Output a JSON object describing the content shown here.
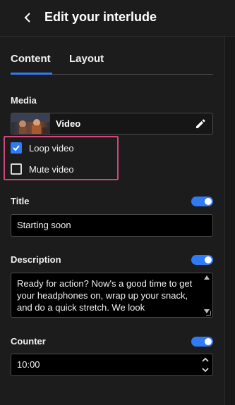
{
  "header": {
    "title": "Edit your interlude",
    "back_icon": "chevron-left-icon"
  },
  "tabs": [
    {
      "label": "Content",
      "active": true
    },
    {
      "label": "Layout",
      "active": false
    }
  ],
  "accent_color": "#2f7bf5",
  "highlight_color": "#d0467d",
  "media": {
    "section_label": "Media",
    "card_label": "Video",
    "edit_icon": "pencil-icon",
    "loop": {
      "label": "Loop video",
      "checked": true
    },
    "mute": {
      "label": "Mute video",
      "checked": false
    }
  },
  "title_section": {
    "label": "Title",
    "enabled": true,
    "value": "Starting soon"
  },
  "description_section": {
    "label": "Description",
    "enabled": true,
    "value": "Ready for action? Now's a good time to get your headphones on, wrap up your snack, and do a quick stretch. We look"
  },
  "counter_section": {
    "label": "Counter",
    "enabled": true,
    "value": "10:00"
  }
}
